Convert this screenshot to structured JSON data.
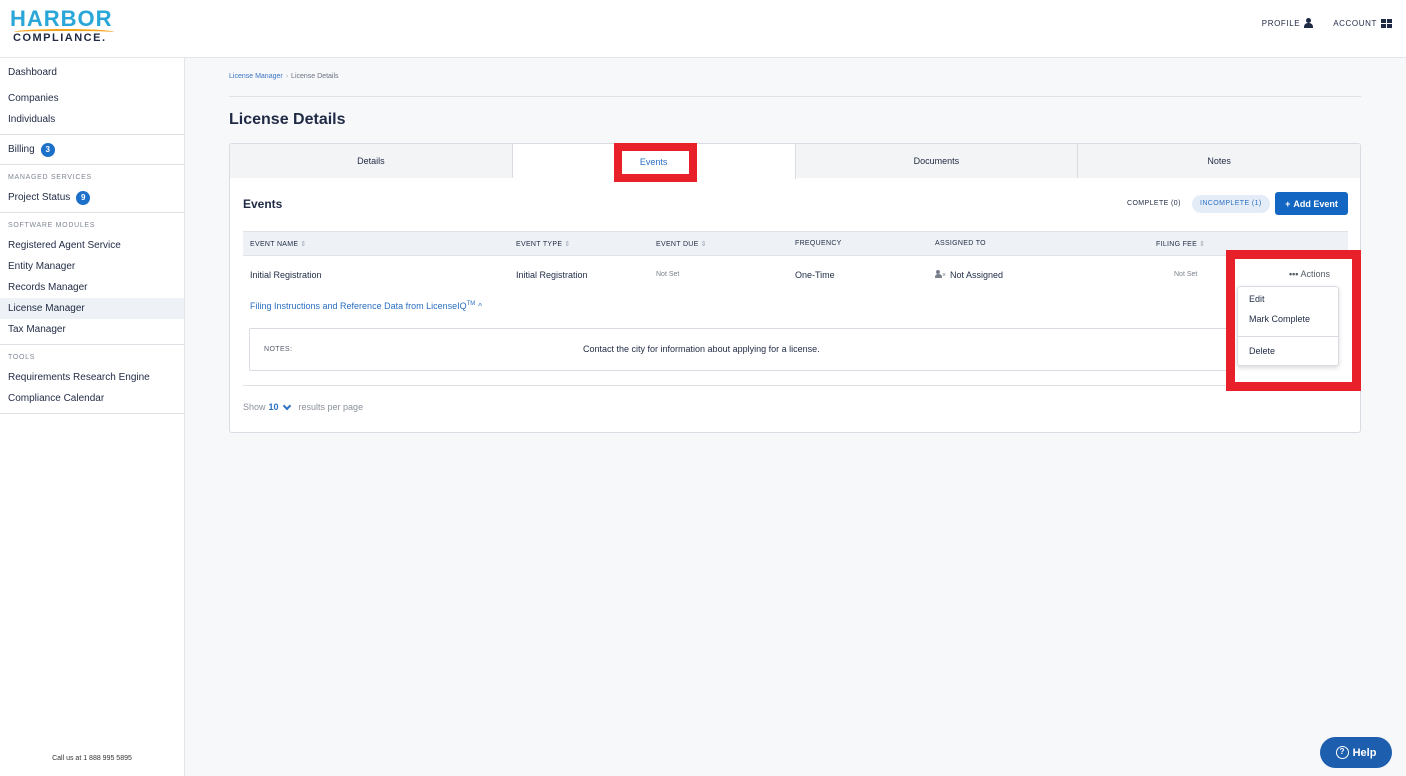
{
  "brand": {
    "line1": "HARBOR",
    "line2": "COMPLIANCE."
  },
  "header": {
    "profile_label": "PROFILE",
    "account_label": "ACCOUNT"
  },
  "sidebar": {
    "groups": [
      {
        "items": [
          {
            "label": "Dashboard"
          },
          {
            "label": "Companies"
          },
          {
            "label": "Individuals"
          }
        ]
      },
      {
        "items": [
          {
            "label": "Billing",
            "badge": "3"
          }
        ]
      },
      {
        "heading": "MANAGED SERVICES",
        "items": [
          {
            "label": "Project Status",
            "badge": "9"
          }
        ]
      },
      {
        "heading": "SOFTWARE MODULES",
        "items": [
          {
            "label": "Registered Agent Service"
          },
          {
            "label": "Entity Manager"
          },
          {
            "label": "Records Manager"
          },
          {
            "label": "License Manager"
          },
          {
            "label": "Tax Manager"
          }
        ]
      },
      {
        "heading": "TOOLS",
        "items": [
          {
            "label": "Requirements Research Engine"
          },
          {
            "label": "Compliance Calendar"
          }
        ]
      }
    ],
    "footer": "Call us at 1  888  995  5895"
  },
  "breadcrumb": {
    "parent": "License Manager",
    "current": "License Details"
  },
  "page_title": "License Details",
  "tabs": [
    {
      "label": "Details"
    },
    {
      "label": "Events"
    },
    {
      "label": "Documents"
    },
    {
      "label": "Notes"
    }
  ],
  "events": {
    "title": "Events",
    "filter_complete": "COMPLETE (0)",
    "filter_incomplete": "INCOMPLETE (1)",
    "add_button": "Add Event",
    "columns": {
      "name": "EVENT NAME",
      "type": "EVENT TYPE",
      "due": "EVENT DUE",
      "frequency": "FREQUENCY",
      "assigned": "ASSIGNED TO",
      "fee": "FILING FEE"
    },
    "row": {
      "name": "Initial Registration",
      "type": "Initial Registration",
      "due": "Not Set",
      "frequency": "One-Time",
      "assigned": "Not Assigned",
      "fee": "Not Set",
      "actions": "Actions"
    },
    "filing_link": "Filing Instructions and Reference Data from LicenseIQ",
    "filing_link_sup": "TM",
    "notes_label": "NOTES:",
    "notes_text": "Contact the city for information about applying for a license.",
    "show_label": "Show",
    "per_page": "10",
    "per_page_suffix": "results per page"
  },
  "actions_menu": [
    {
      "label": "Edit"
    },
    {
      "label": "Mark Complete"
    },
    {
      "label": "Delete"
    }
  ],
  "help_label": "Help",
  "colors": {
    "highlight": "#e8202a",
    "primary": "#1366c2",
    "link": "#2a6fc2"
  }
}
